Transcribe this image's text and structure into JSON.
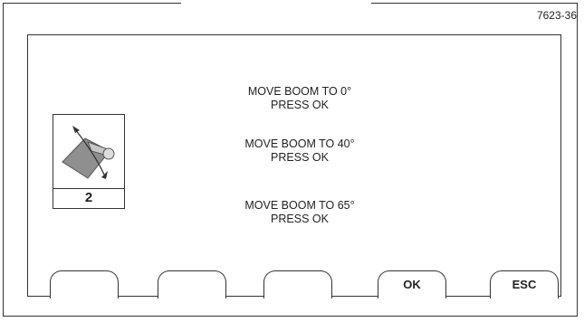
{
  "figure_id": "7623-36",
  "step": {
    "number": "2",
    "icon": "boom-angle-icon"
  },
  "instructions": [
    {
      "line1": "MOVE BOOM TO 0°",
      "line2": "PRESS OK"
    },
    {
      "line1": "MOVE BOOM TO 40°",
      "line2": "PRESS OK"
    },
    {
      "line1": "MOVE BOOM TO 65°",
      "line2": "PRESS OK"
    }
  ],
  "softkeys": {
    "key1": "",
    "key2": "",
    "key3": "",
    "ok": "OK",
    "esc": "ESC"
  }
}
